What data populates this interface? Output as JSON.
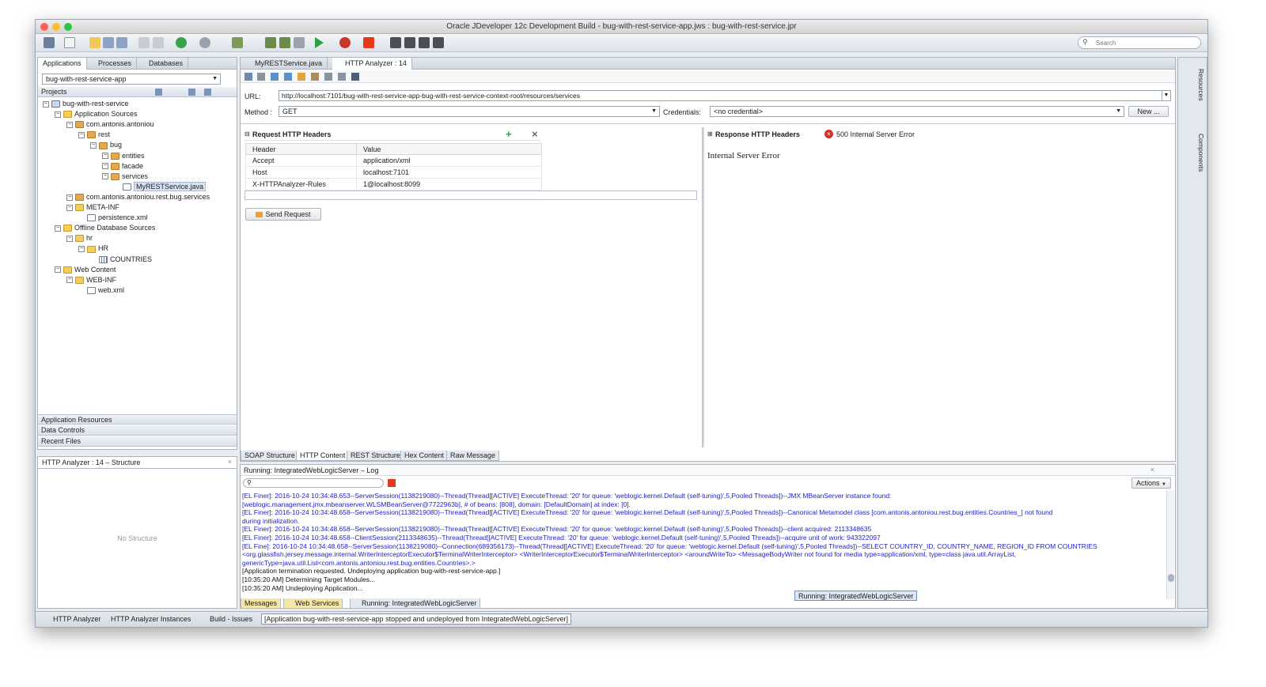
{
  "window": {
    "title": "Oracle JDeveloper 12c Development Build - bug-with-rest-service-app.jws : bug-with-rest-service.jpr",
    "search_placeholder": "Search"
  },
  "left_panel": {
    "tabs": [
      "Applications",
      "Processes",
      "Databases"
    ],
    "app_selector": "bug-with-rest-service-app",
    "projects_label": "Projects",
    "tree": [
      {
        "label": "bug-with-rest-service",
        "icon": "project-icon",
        "depth": 0
      },
      {
        "label": "Application Sources",
        "icon": "folder-icon",
        "depth": 1
      },
      {
        "label": "com.antonis.antoniou",
        "icon": "package-icon",
        "depth": 2
      },
      {
        "label": "rest",
        "icon": "package-icon",
        "depth": 3
      },
      {
        "label": "bug",
        "icon": "package-icon",
        "depth": 4
      },
      {
        "label": "entities",
        "icon": "package-icon",
        "depth": 5
      },
      {
        "label": "facade",
        "icon": "package-icon",
        "depth": 5
      },
      {
        "label": "services",
        "icon": "package-icon",
        "depth": 5
      },
      {
        "label": "MyRESTService.java",
        "icon": "java-file-icon",
        "depth": 6,
        "selected": true
      },
      {
        "label": "com.antonis.antoniou.rest.bug.services",
        "icon": "package-icon",
        "depth": 2
      },
      {
        "label": "META-INF",
        "icon": "folder-icon",
        "depth": 2
      },
      {
        "label": "persistence.xml",
        "icon": "xml-file-icon",
        "depth": 3
      },
      {
        "label": "Offline Database Sources",
        "icon": "folder-icon",
        "depth": 1
      },
      {
        "label": "hr",
        "icon": "folder-icon",
        "depth": 2
      },
      {
        "label": "HR",
        "icon": "folder-icon",
        "depth": 3
      },
      {
        "label": "COUNTRIES",
        "icon": "table-icon",
        "depth": 4
      },
      {
        "label": "Web Content",
        "icon": "folder-icon",
        "depth": 1
      },
      {
        "label": "WEB-INF",
        "icon": "folder-icon",
        "depth": 2
      },
      {
        "label": "web.xml",
        "icon": "xml-file-icon",
        "depth": 3
      }
    ],
    "sections": [
      "Application Resources",
      "Data Controls",
      "Recent Files"
    ],
    "structure_title": "HTTP Analyzer : 14 – Structure",
    "structure_empty": "No Structure"
  },
  "editor": {
    "tabs": [
      "MyRESTService.java",
      "HTTP Analyzer : 14"
    ],
    "url_label": "URL:",
    "url_value": "http://localhost:7101/bug-with-rest-service-app-bug-with-rest-service-context-root/resources/services",
    "method_label": "Method :",
    "method_value": "GET",
    "credentials_label": "Credentials:",
    "credentials_value": "<no credential>",
    "new_button": "New ...",
    "request_title": "Request HTTP Headers",
    "request_columns": [
      "Header",
      "Value"
    ],
    "request_rows": [
      [
        "Accept",
        "application/xml"
      ],
      [
        "Host",
        "localhost:7101"
      ],
      [
        "X-HTTPAnalyzer-Rules",
        "1@localhost:8099"
      ]
    ],
    "send_button": "Send Request",
    "response_title": "Response HTTP Headers",
    "response_status": "500 Internal Server Error",
    "response_body": "Internal Server Error",
    "bottom_tabs": [
      "SOAP Structure",
      "HTTP Content",
      "REST Structure",
      "Hex Content",
      "Raw Message"
    ]
  },
  "log": {
    "title": "Running: IntegratedWebLogicServer – Log",
    "actions_label": "Actions",
    "lines": [
      {
        "text": "[EL Finer]: 2016-10-24 10:34:48.653--ServerSession(1138219080)--Thread(Thread[[ACTIVE] ExecuteThread: '20' for queue: 'weblogic.kernel.Default (self-tuning)',5,Pooled Threads])--JMX MBeanServer instance found:",
        "blue": true
      },
      {
        "text": "[weblogic.management.jmx.mbeanserver.WLSMBeanServer@7722963b], # of beans: [808], domain: [DefaultDomain] at index: [0].",
        "blue": true
      },
      {
        "text": "[EL Finer]: 2016-10-24 10:34:48.658--ServerSession(1138219080)--Thread(Thread[[ACTIVE] ExecuteThread: '20' for queue: 'weblogic.kernel.Default (self-tuning)',5,Pooled Threads])--Canonical Metamodel class [com.antonis.antoniou.rest.bug.entities.Countries_] not found",
        "blue": true
      },
      {
        "text": "during initialization.",
        "blue": true
      },
      {
        "text": "[EL Finer]: 2016-10-24 10:34:48.658--ServerSession(1138219080)--Thread(Thread[[ACTIVE] ExecuteThread: '20' for queue: 'weblogic.kernel.Default (self-tuning)',5,Pooled Threads])--client acquired: 2113348635",
        "blue": true
      },
      {
        "text": "[EL Finer]: 2016-10-24 10:34:48.658--ClientSession(2113348635)--Thread(Thread[[ACTIVE] ExecuteThread: '20' for queue: 'weblogic.kernel.Default (self-tuning)',5,Pooled Threads])--acquire unit of work: 943322097",
        "blue": true
      },
      {
        "text": "[EL Fine]: 2016-10-24 10:34:48.658--ServerSession(1138219080)--Connection(689356173)--Thread(Thread[[ACTIVE] ExecuteThread: '20' for queue: 'weblogic.kernel.Default (self-tuning)',5,Pooled Threads])--SELECT COUNTRY_ID, COUNTRY_NAME, REGION_ID FROM COUNTRIES",
        "blue": true
      },
      {
        "text": "<org.glassfish.jersey.message.internal.WriterInterceptorExecutor$TerminalWriterInterceptor> <WriterInterceptorExecutor$TerminalWriterInterceptor> <aroundWriteTo> <MessageBodyWriter not found for media type=application/xml, type=class java.util.ArrayList,",
        "blue": true
      },
      {
        "text": "genericType=java.util.List<com.antonis.antoniou.rest.bug.entities.Countries>.>",
        "blue": true
      },
      {
        "text": "[Application termination requested.  Undeploying application bug-with-rest-service-app.]",
        "blue": false
      },
      {
        "text": "[10:35:20 AM] Determining Target Modules...",
        "blue": false
      },
      {
        "text": "[10:35:20 AM] Undeploying Application...",
        "blue": false
      }
    ],
    "tooltip": "Running: IntegratedWebLogicServer",
    "tabs": [
      "Messages",
      "Web Services",
      "Running: IntegratedWebLogicServer"
    ]
  },
  "status_bar": {
    "items": [
      "HTTP Analyzer",
      "HTTP Analyzer Instances",
      "Build - Issues"
    ],
    "message": "[Application bug-with-rest-service-app stopped and undeployed from IntegratedWebLogicServer]"
  },
  "right_strip": {
    "tabs": [
      "Resources",
      "Components"
    ]
  },
  "colors": {
    "log_blue": "#1f1fcc",
    "error_red": "#d93025",
    "close_red": "#ff5f57",
    "minimize_yellow": "#febc2e",
    "zoom_green": "#28c840"
  }
}
